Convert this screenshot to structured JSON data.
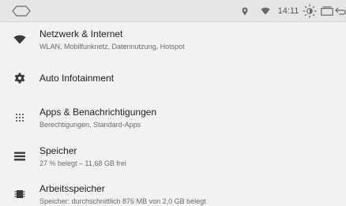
{
  "status_bar": {
    "time": "14:11",
    "icons": [
      "home-icon",
      "location-icon",
      "wifi-icon",
      "brightness-icon",
      "recents-icon",
      "back-icon"
    ]
  },
  "settings": {
    "items": [
      {
        "icon": "wifi-icon",
        "title": "Netzwerk & Internet",
        "subtitle": "WLAN, Mobilfunknetz, Datennutzung, Hotspot"
      },
      {
        "icon": "gear-icon",
        "title": "Auto Infotainment",
        "subtitle": ""
      },
      {
        "icon": "apps-grid-icon",
        "title": "Apps & Benachrichtigungen",
        "subtitle": "Berechtigungen, Standard-Apps"
      },
      {
        "icon": "storage-icon",
        "title": "Speicher",
        "subtitle": "27 % belegt – 11,68 GB frei"
      },
      {
        "icon": "memory-icon",
        "title": "Arbeitsspeicher",
        "subtitle": "Speicher: durchschnittlich 876 MB von 2,0 GB belegt"
      }
    ]
  },
  "colors": {
    "background": "#f2f2f2",
    "status_bar": "#e6e6e6",
    "icon": "#3a3a3a",
    "title_text": "#1f1f1f",
    "subtitle_text": "#6b6b6b"
  }
}
